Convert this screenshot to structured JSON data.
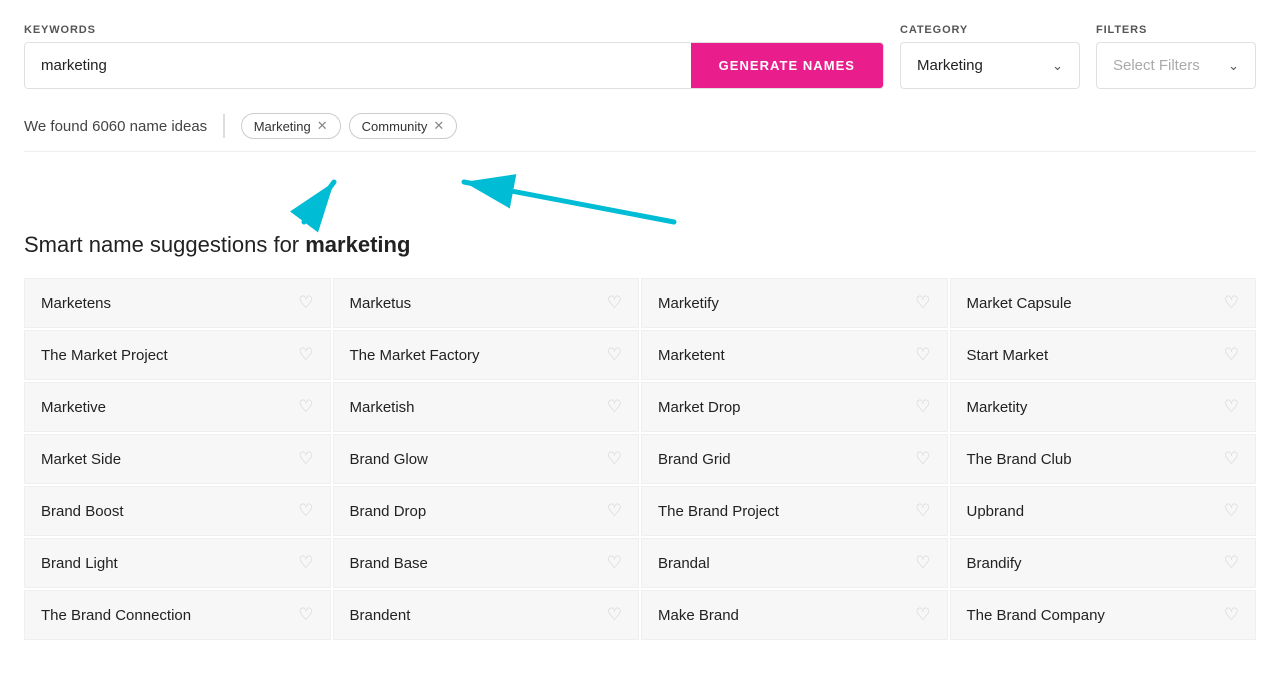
{
  "header": {
    "keywords_label": "KEYWORDS",
    "keywords_value": "marketing",
    "keywords_placeholder": "marketing",
    "generate_label": "GENERATE NAMES",
    "category_label": "CATEGORY",
    "category_value": "Marketing",
    "filters_label": "FILTERS",
    "filters_placeholder": "Select Filters"
  },
  "results": {
    "count_text": "We found 6060 name ideas",
    "tags": [
      {
        "label": "Marketing",
        "id": "tag-marketing"
      },
      {
        "label": "Community",
        "id": "tag-community"
      }
    ]
  },
  "suggestion": {
    "prefix": "Smart name suggestions for ",
    "keyword": "marketing"
  },
  "names": [
    [
      "Marketens",
      "Marketus",
      "Marketify",
      "Market Capsule"
    ],
    [
      "The Market Project",
      "The Market Factory",
      "Marketent",
      "Start Market"
    ],
    [
      "Marketive",
      "Marketish",
      "Market Drop",
      "Marketity"
    ],
    [
      "Market Side",
      "Brand Glow",
      "Brand Grid",
      "The Brand Club"
    ],
    [
      "Brand Boost",
      "Brand Drop",
      "The Brand Project",
      "Upbrand"
    ],
    [
      "Brand Light",
      "Brand Base",
      "Brandal",
      "Brandify"
    ],
    [
      "The Brand Connection",
      "Brandent",
      "Make Brand",
      "The Brand Company"
    ]
  ],
  "colors": {
    "pink": "#e91e8c",
    "cyan": "#00bcd4"
  }
}
